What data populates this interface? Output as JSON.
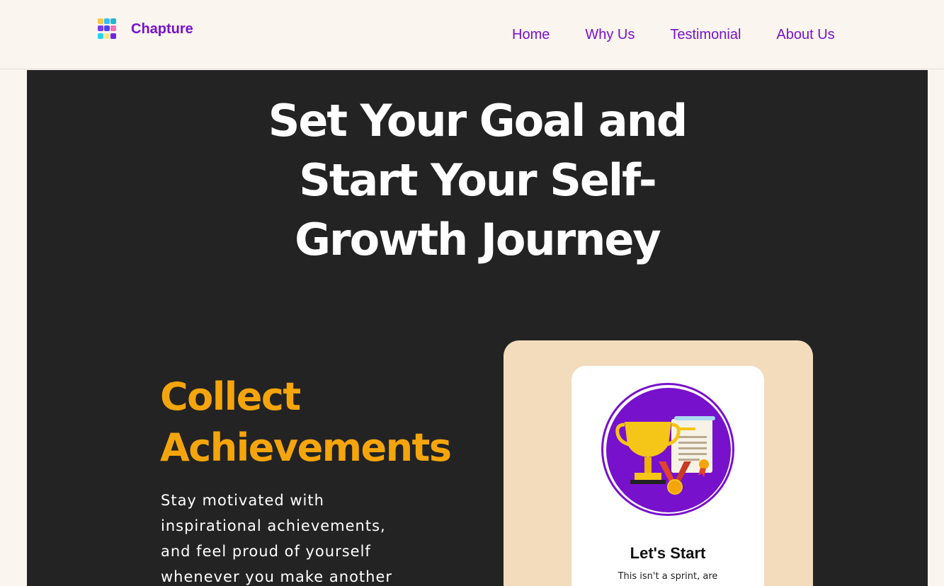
{
  "brand": {
    "name": "Chapture",
    "logo_icon": "grid-logo-icon",
    "logo_colors": [
      "#f7c948",
      "#38bdf8",
      "#22b8cf",
      "#7c3aed",
      "#4f46e5",
      "#f472b6",
      "#22d3ee",
      "#fde68a",
      "#6d28d9"
    ]
  },
  "nav": {
    "items": [
      {
        "label": "Home"
      },
      {
        "label": "Why Us"
      },
      {
        "label": "Testimonial"
      },
      {
        "label": "About Us"
      }
    ]
  },
  "hero": {
    "title": "Set Your Goal and Start Your Self-Growth Journey"
  },
  "feature": {
    "title": "Collect Achievements",
    "text": "Stay motivated with inspirational achievements, and feel proud of yourself whenever you make another"
  },
  "card": {
    "icon": "trophy-certificate-medal-icon",
    "title": "Let's Start",
    "text": "This isn't a sprint, are"
  },
  "colors": {
    "accent": "#7711cc",
    "highlight": "#f5a50c",
    "hero_bg": "#232323",
    "page_bg": "#fbf5ef",
    "card_bg": "#f3dcbb"
  }
}
